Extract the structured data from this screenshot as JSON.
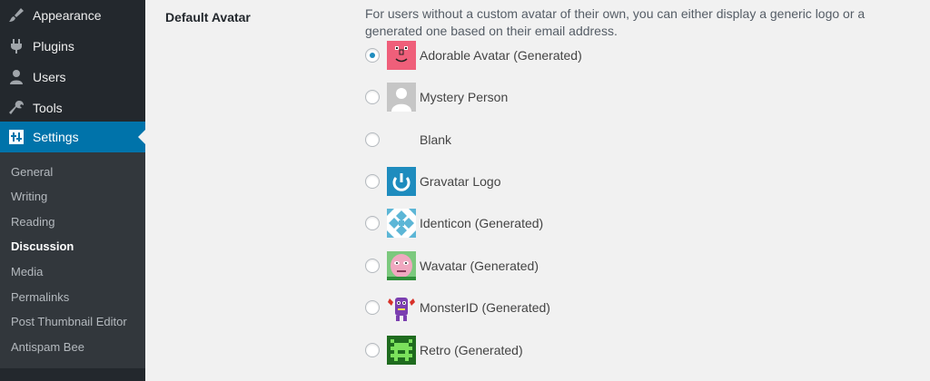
{
  "sidebar": {
    "menu": [
      {
        "label": "Appearance",
        "icon": "paintbrush-icon"
      },
      {
        "label": "Plugins",
        "icon": "plug-icon"
      },
      {
        "label": "Users",
        "icon": "user-icon"
      },
      {
        "label": "Tools",
        "icon": "wrench-icon"
      },
      {
        "label": "Settings",
        "icon": "settings-icon",
        "current": true
      }
    ],
    "submenu": [
      {
        "label": "General"
      },
      {
        "label": "Writing"
      },
      {
        "label": "Reading"
      },
      {
        "label": "Discussion",
        "current": true
      },
      {
        "label": "Media"
      },
      {
        "label": "Permalinks"
      },
      {
        "label": "Post Thumbnail Editor"
      },
      {
        "label": "Antispam Bee"
      }
    ]
  },
  "main": {
    "row_label": "Default Avatar",
    "description": "For users without a custom avatar of their own, you can either display a generic logo or a generated one based on their email address.",
    "options": [
      {
        "label": "Adorable Avatar (Generated)",
        "icon": "adorable-avatar-icon",
        "checked": true
      },
      {
        "label": "Mystery Person",
        "icon": "mystery-person-icon"
      },
      {
        "label": "Blank",
        "icon": "blank-avatar-icon"
      },
      {
        "label": "Gravatar Logo",
        "icon": "gravatar-logo-icon"
      },
      {
        "label": "Identicon (Generated)",
        "icon": "identicon-icon"
      },
      {
        "label": "Wavatar (Generated)",
        "icon": "wavatar-icon"
      },
      {
        "label": "MonsterID (Generated)",
        "icon": "monsterid-icon"
      },
      {
        "label": "Retro (Generated)",
        "icon": "retro-icon"
      }
    ]
  },
  "colors": {
    "sidebar_bg": "#23282d",
    "submenu_bg": "#32373c",
    "accent": "#0073aa",
    "page_bg": "#f1f1f1"
  }
}
